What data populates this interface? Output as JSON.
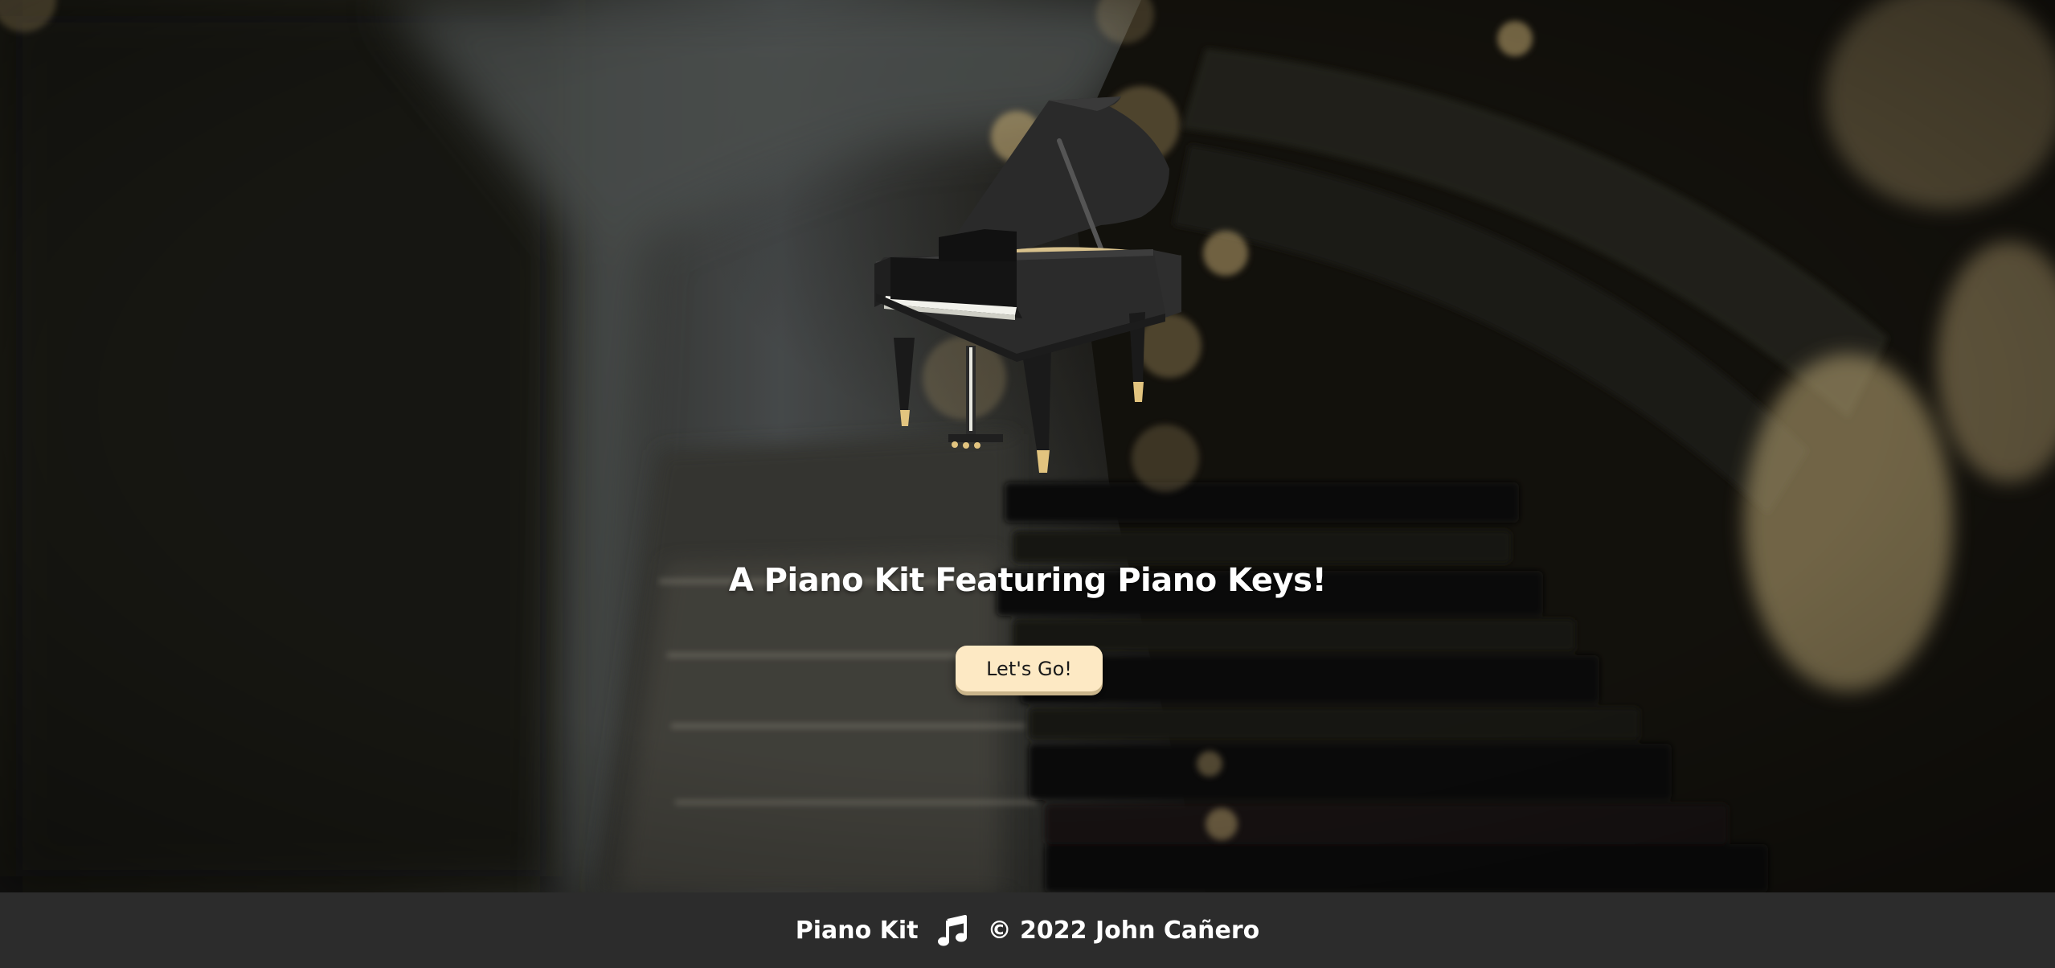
{
  "hero": {
    "title": "A Piano Kit Featuring Piano Keys!",
    "cta_label": "Let's Go!"
  },
  "footer": {
    "brand": "Piano Kit",
    "icon": "music-note-icon",
    "copyright": "© 2022 John Cañero"
  },
  "colors": {
    "button_bg": "#fde9c4",
    "footer_bg": "#2c2c2c",
    "text": "#ffffff",
    "accent_gold": "#e2c47f"
  }
}
